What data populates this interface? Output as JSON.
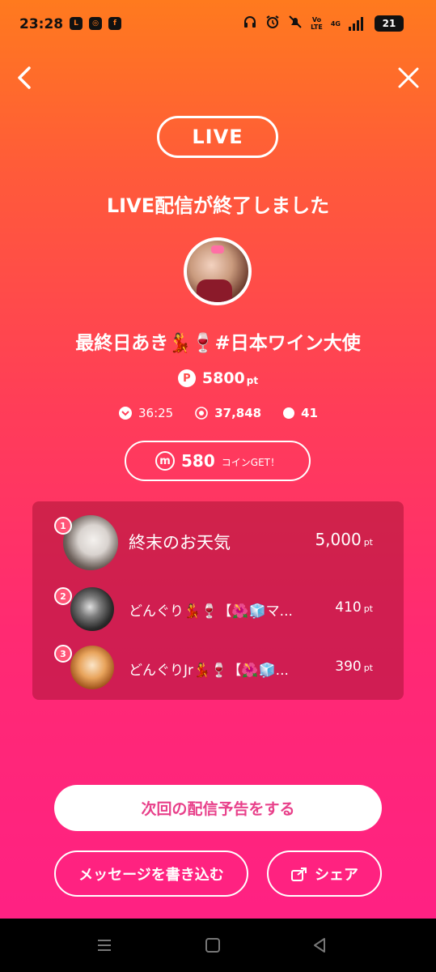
{
  "status_bar": {
    "time": "23:28",
    "apps": [
      "LINE",
      "Instagram",
      "Facebook"
    ],
    "icons": [
      "headphones-icon",
      "alarm-icon",
      "mute-icon"
    ],
    "volte": "Vo\nLTE",
    "network": "4G",
    "battery": "21"
  },
  "header": {
    "live_label": "LIVE",
    "ended_title": "LIVE配信が終了しました"
  },
  "streamer": {
    "name": "最終日あき💃🍷#日本ワイン大使",
    "points_badge": "P",
    "points": "5800",
    "points_unit": "pt"
  },
  "stats": {
    "duration": "36:25",
    "views": "37,848",
    "comments": "41"
  },
  "coin": {
    "icon_letter": "m",
    "value": "580",
    "label": "コインGET！"
  },
  "ranking": [
    {
      "rank": "1",
      "name": "終末のお天気",
      "points": "5,000",
      "unit": "pt"
    },
    {
      "rank": "2",
      "name": "どんぐり💃🍷【🌺🧊マ...",
      "points": "410",
      "unit": "pt"
    },
    {
      "rank": "3",
      "name": "どんぐりJr💃🍷【🌺🧊...",
      "points": "390",
      "unit": "pt"
    }
  ],
  "buttons": {
    "announce": "次回の配信予告をする",
    "message": "メッセージを書き込む",
    "share": "シェア"
  },
  "colors": {
    "gradient_top": "#FF7A1E",
    "gradient_bottom": "#FF1F86",
    "announce_text": "#E8408A",
    "rank_badge": "#FF5577"
  }
}
